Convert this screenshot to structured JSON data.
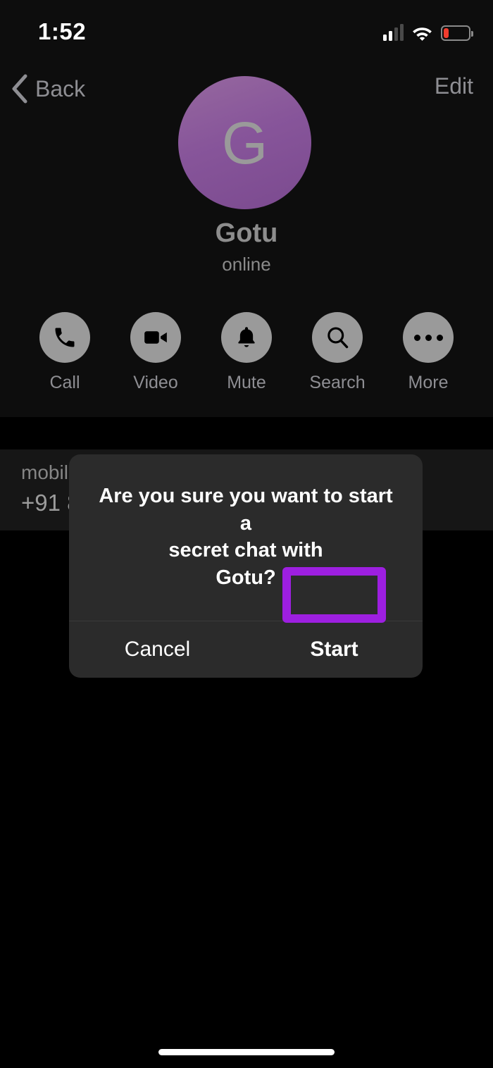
{
  "status_bar": {
    "time": "1:52",
    "signal_icon": "cellular-signal-icon",
    "signal_bars_active": 2,
    "signal_bars_total": 4,
    "wifi_icon": "wifi-icon",
    "battery_icon": "battery-low-icon",
    "battery_color": "#f03c2e"
  },
  "header": {
    "back_label": "Back",
    "back_icon": "chevron-left-icon",
    "edit_label": "Edit",
    "avatar_initial": "G",
    "avatar_color": "#87559a",
    "profile_name": "Gotu",
    "profile_status": "online"
  },
  "actions": [
    {
      "label": "Call",
      "icon": "phone-icon"
    },
    {
      "label": "Video",
      "icon": "video-camera-icon"
    },
    {
      "label": "Mute",
      "icon": "bell-icon"
    },
    {
      "label": "Search",
      "icon": "search-icon"
    },
    {
      "label": "More",
      "icon": "ellipsis-icon"
    }
  ],
  "info": {
    "label": "mobile",
    "value": "+91 8"
  },
  "dialog": {
    "message": "Are you sure you want to start a\nsecret chat with\nGotu?",
    "cancel_label": "Cancel",
    "start_label": "Start",
    "highlight_color": "#9d1fe0",
    "highlighted_button": "Start"
  },
  "system": {
    "home_indicator": "home-indicator"
  }
}
